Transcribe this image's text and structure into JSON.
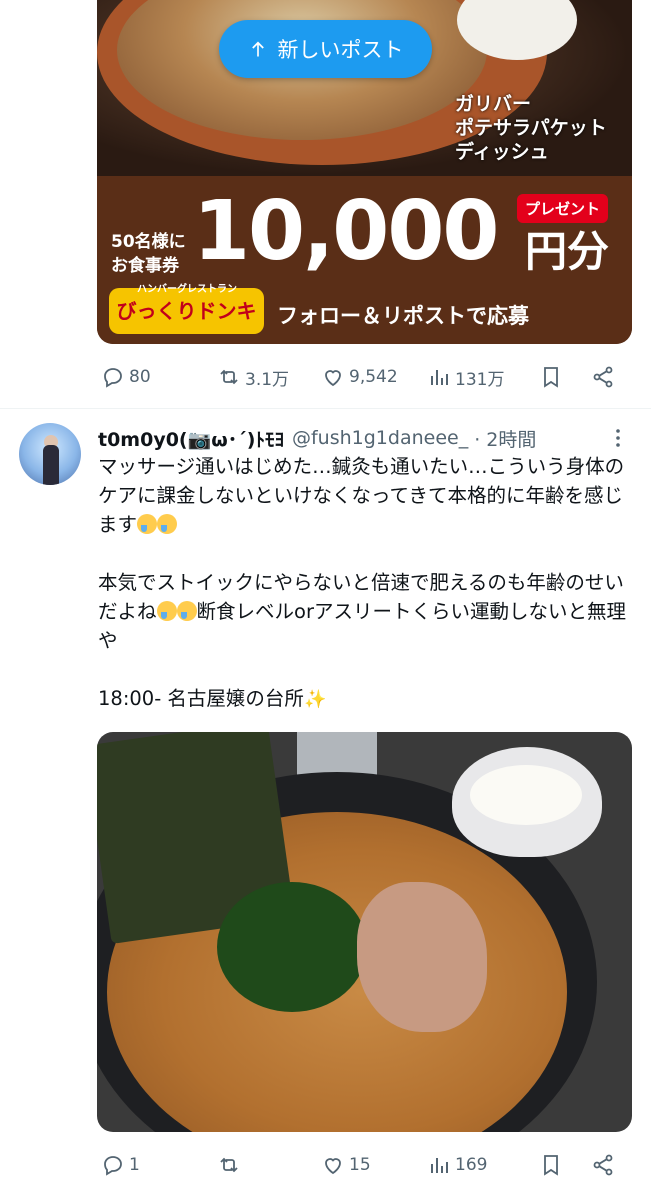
{
  "new_posts_pill": {
    "label": "新しいポスト"
  },
  "ad_post": {
    "image": {
      "caption": "ガリバー\nポテサラパケット\nディッシュ",
      "small_text": "50名様に\nお食事券",
      "amount": "10,000",
      "unit": "円分",
      "badge": "プレゼント",
      "logo_sub": "ハンバーグレストラン",
      "logo": "びっくりドンキー",
      "cta": "フォロー＆リポストで応募"
    },
    "actions": {
      "replies": "80",
      "reposts": "3.1万",
      "likes": "9,542",
      "views": "131万"
    }
  },
  "post": {
    "display_name": "t0m0y0(📷ω･´)ﾄﾓﾖ",
    "handle": "@fush1g1daneee_",
    "time": "· 2時間",
    "text_line1": "マッサージ通いはじめた…鍼灸も通いたい…こういう身体のケアに課金しないといけなくなってきて本格的に年齢を感じます",
    "text_line2": "本気でストイックにやらないと倍速で肥えるのも年齢のせいだよね",
    "text_line3": "断食レベルorアスリートくらい運動しないと無理や",
    "text_line4": "18:00- 名古屋嬢の台所",
    "actions": {
      "replies": "1",
      "reposts": "",
      "likes": "15",
      "views": "169"
    }
  }
}
